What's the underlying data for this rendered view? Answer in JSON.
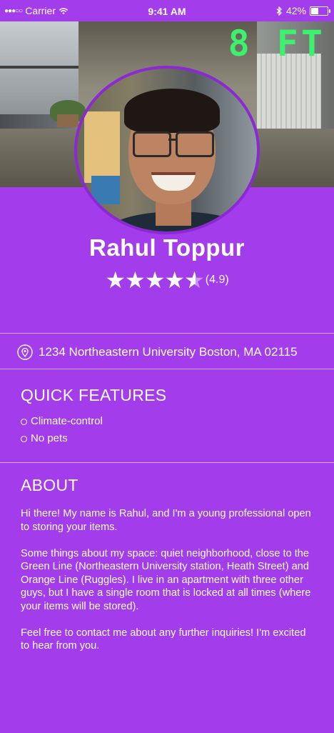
{
  "status_bar": {
    "carrier": "Carrier",
    "time": "9:41 AM",
    "battery": "42%"
  },
  "hero": {
    "overlay_text": "8 FT"
  },
  "profile": {
    "name": "Rahul Toppur",
    "rating_value": 4.5,
    "rating_text": "(4.9)"
  },
  "address": {
    "text": "1234 Northeastern University Boston, MA 02115",
    "icon": "location-pin-icon"
  },
  "quick_features": {
    "title": "QUICK FEATURES",
    "items": [
      "Climate-control",
      "No pets"
    ]
  },
  "about": {
    "title": "ABOUT",
    "paragraphs": [
      "Hi there! My name is Rahul, and I'm a young professional open to storing your items.",
      "Some things about my space: quiet neighborhood, close to the Green Line (Northeastern University station, Heath Street) and Orange Line (Ruggles). I live in an apartment with three other guys, but I have a single room that is locked at all times (where your items will be stored).",
      "Feel free to contact me about any further inquiries! I'm excited to hear from you."
    ]
  },
  "colors": {
    "background": "#a33ceb",
    "avatar_border": "#8c28d6",
    "overlay_text": "#3df06e"
  }
}
